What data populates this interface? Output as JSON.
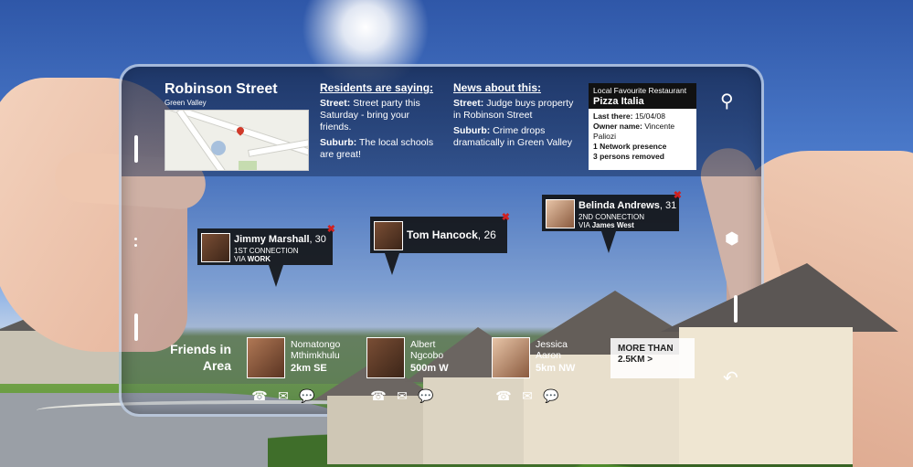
{
  "header": {
    "street": "Robinson Street",
    "suburb": "Green Valley"
  },
  "residents": {
    "heading": "Residents are saying:",
    "street_label": "Street:",
    "street_text": "Street party this Saturday - bring your friends.",
    "suburb_label": "Suburb:",
    "suburb_text": "The local schools are great!"
  },
  "news": {
    "heading": "News about this:",
    "street_label": "Street:",
    "street_text": "Judge buys property in Robinson Street",
    "suburb_label": "Suburb:",
    "suburb_text": "Crime drops dramatically in Green Valley"
  },
  "restaurant": {
    "title": "Local Favourite Restaurant",
    "name": "Pizza Italia",
    "last_there_label": "Last there:",
    "last_there": "15/04/08",
    "owner_label": "Owner name:",
    "owner": "Vincente Paliozi",
    "network": "1 Network presence",
    "removed": "3 persons removed"
  },
  "tags": [
    {
      "name": "Jimmy Marshall",
      "age": ", 30",
      "conn": "1ST CONNECTION",
      "via_label": "VIA",
      "via": "WORK"
    },
    {
      "name": "Tom Hancock",
      "age": ", 26"
    },
    {
      "name": "Belinda Andrews",
      "age": ", 31",
      "conn": "2ND CONNECTION",
      "via_label": "VIA",
      "via": "James West"
    }
  ],
  "friends": {
    "label_line1": "Friends in",
    "label_line2": "Area",
    "people": [
      {
        "first": "Nomatongo",
        "last": "Mthimkhulu",
        "distance": "2km SE"
      },
      {
        "first": "Albert",
        "last": "Ngcobo",
        "distance": "500m W"
      },
      {
        "first": "Jessica",
        "last": "Aaron",
        "distance": "5km NW"
      }
    ],
    "more_line1": "MORE THAN",
    "more_line2": "2.5KM >"
  },
  "icons": {
    "call": "phone-icon",
    "mail": "mail-icon",
    "chat": "chat-icon",
    "search": "magnifier-icon",
    "hex": "hexagon-icon",
    "back": "undo-arrow-icon",
    "close": "close-icon"
  },
  "colors": {
    "close_red": "#d02020",
    "tag_bg": "#0f0f0f",
    "overlay_top": "#142850"
  }
}
